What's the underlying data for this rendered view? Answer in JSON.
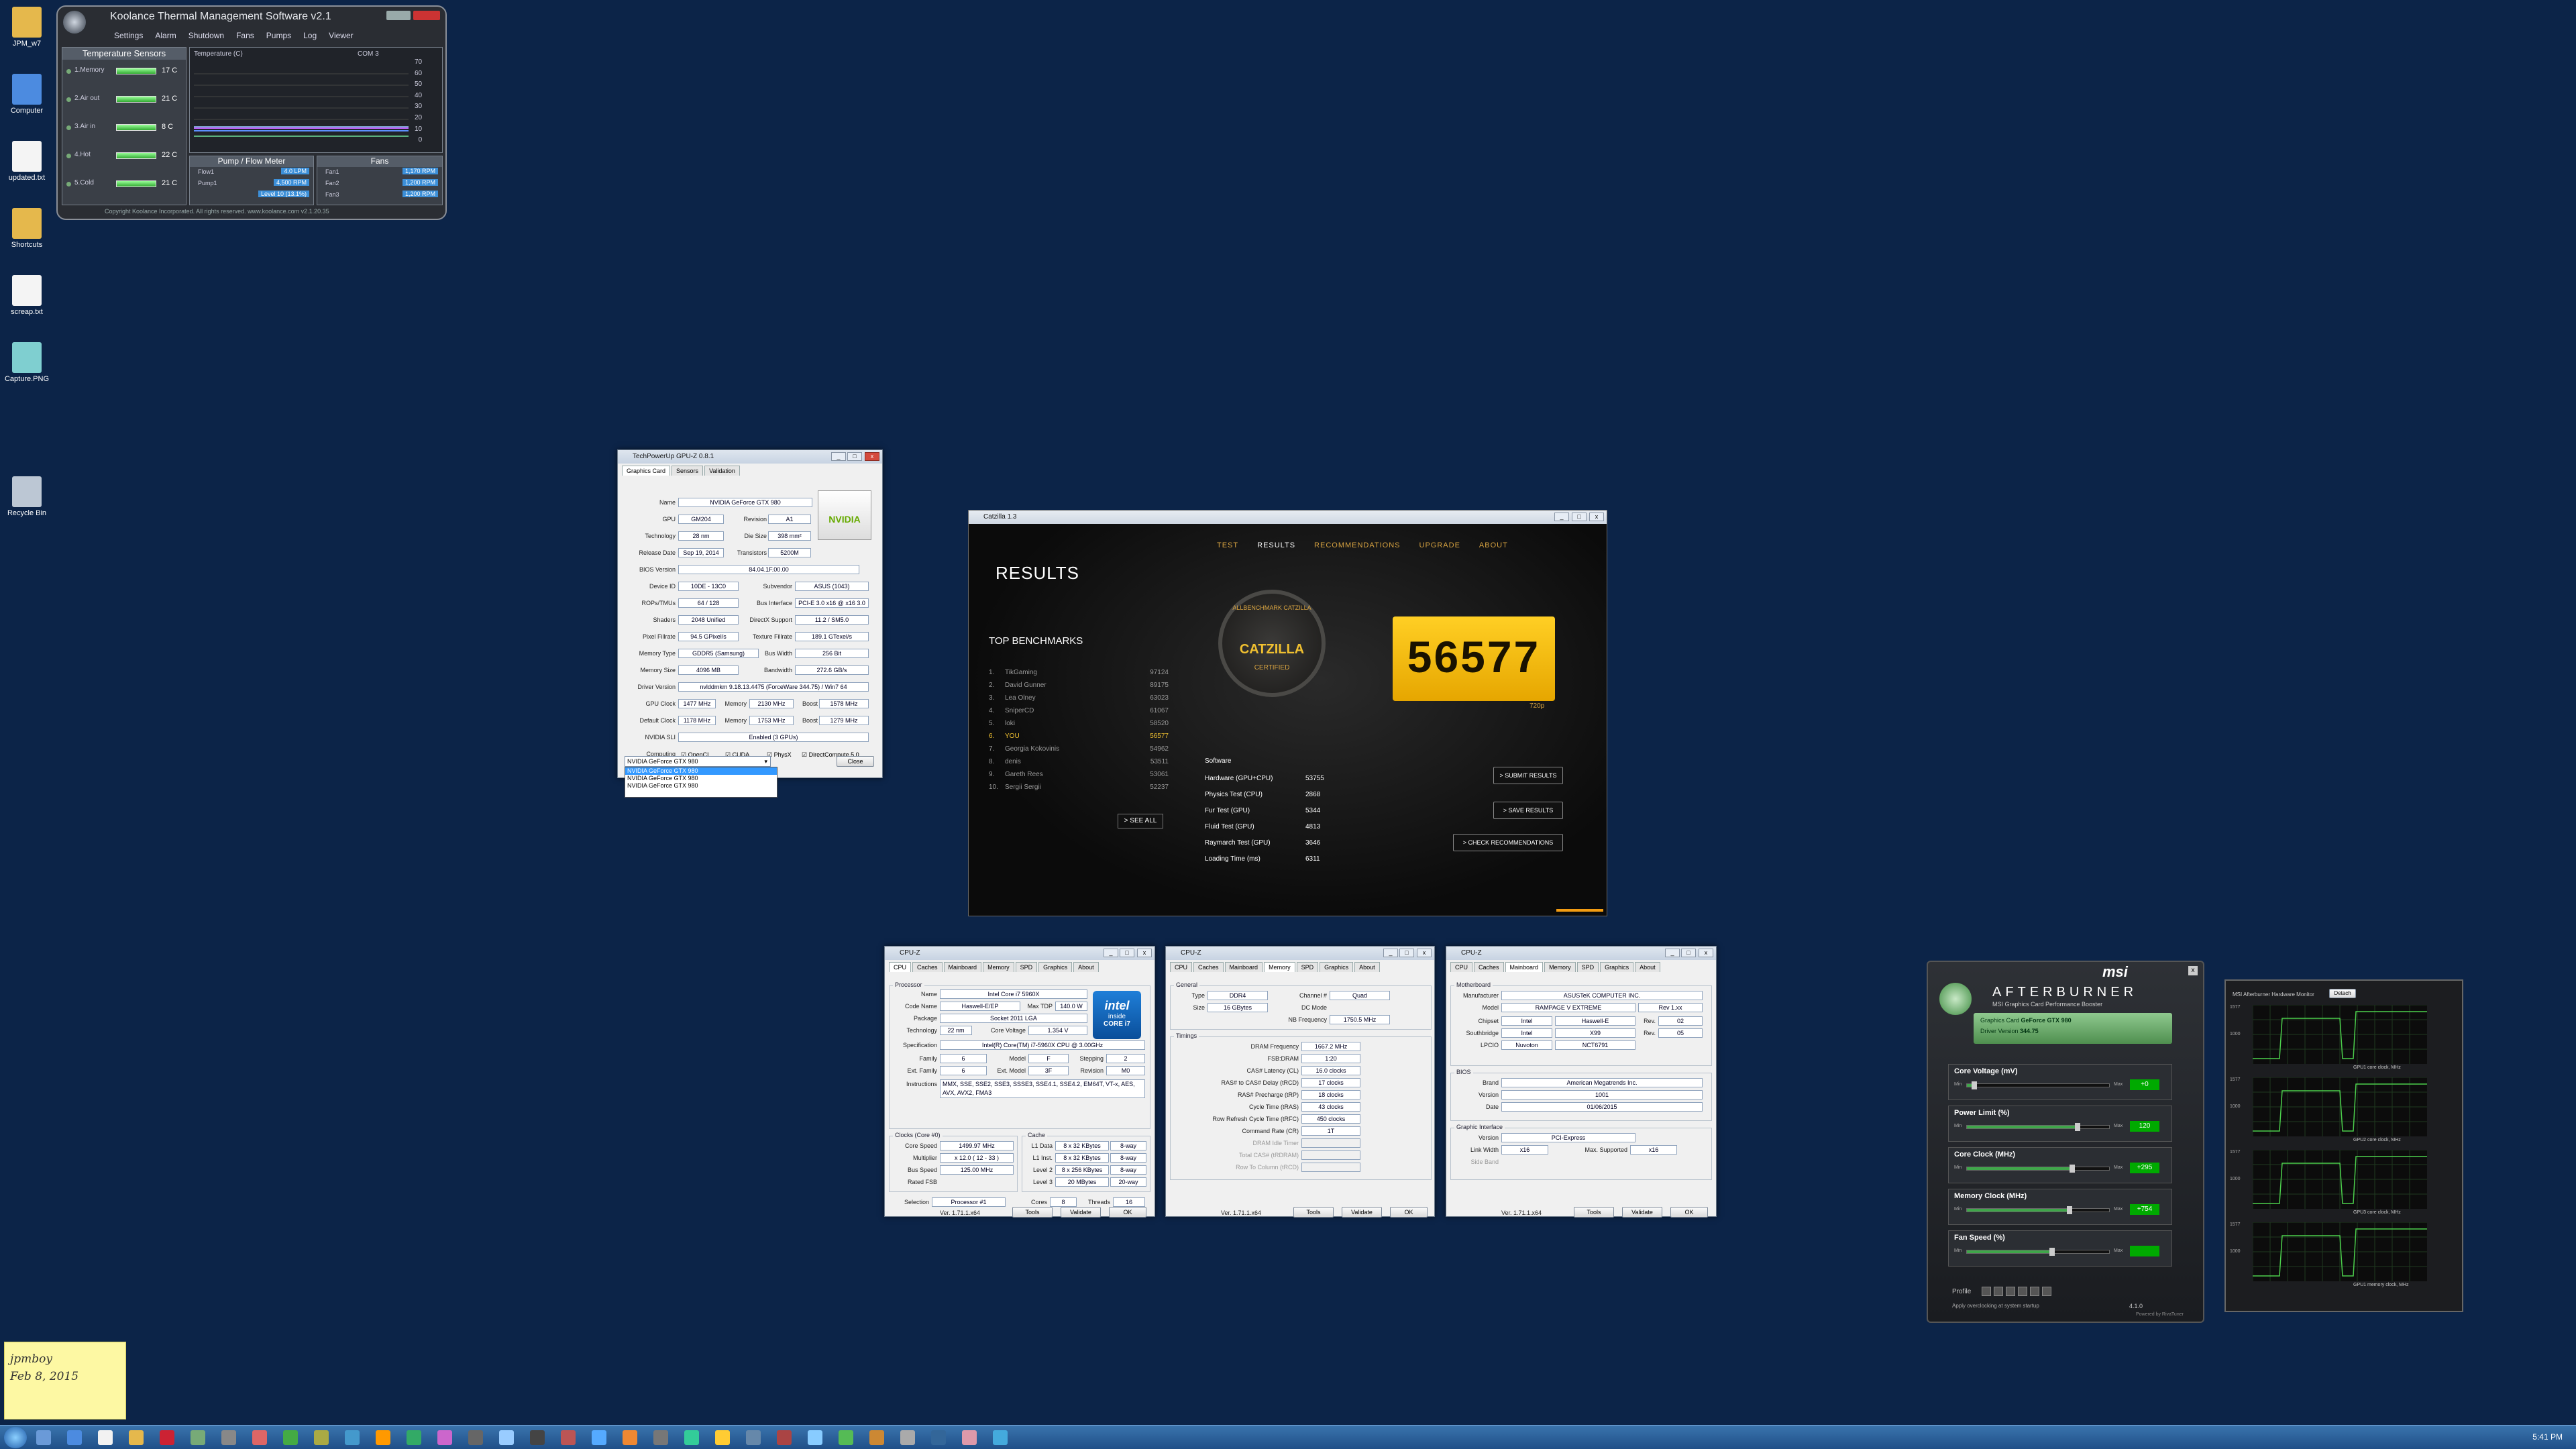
{
  "desktop": {
    "icons": [
      {
        "label": "JPM_w7",
        "color": "#e5b84c"
      },
      {
        "label": "Computer",
        "color": "#4c8be0"
      },
      {
        "label": "updated.txt",
        "color": "#f4f4f4"
      },
      {
        "label": "Shortcuts",
        "color": "#e5b84c"
      },
      {
        "label": "screap.txt",
        "color": "#f4f4f4"
      },
      {
        "label": "Capture.PNG",
        "color": "#7fcfd0"
      },
      {
        "label": "Recycle Bin",
        "color": "#bcc7d4"
      }
    ],
    "note": {
      "line1": "jpmboy",
      "line2": "Feb 8, 2015"
    }
  },
  "koolance": {
    "title": "Koolance Thermal Management Software v2.1",
    "menu": [
      "Settings",
      "Alarm",
      "Shutdown",
      "Fans",
      "Pumps",
      "Log",
      "Viewer"
    ],
    "sensors_title": "Temperature Sensors",
    "sensors": [
      {
        "name": "1.Memory",
        "val": "17 C"
      },
      {
        "name": "2.Air out",
        "val": "21 C"
      },
      {
        "name": "3.Air in",
        "val": "8 C"
      },
      {
        "name": "4.Hot",
        "val": "22 C"
      },
      {
        "name": "5.Cold",
        "val": "21 C"
      }
    ],
    "graph_title": "Temperature (C)",
    "graph_tag": "COM 3",
    "graph_ticks": [
      "70",
      "60",
      "50",
      "40",
      "30",
      "20",
      "10",
      "0"
    ],
    "pump_title": "Pump / Flow Meter",
    "fans_title": "Fans",
    "pump_rows": [
      {
        "name": "Flow1",
        "val": "4.0 LPM"
      },
      {
        "name": "Pump1",
        "val": "4,500 RPM"
      },
      {
        "name": "",
        "val": "Level 10 (13.1%)"
      }
    ],
    "fan_rows": [
      {
        "name": "Fan1",
        "val": "1,170 RPM"
      },
      {
        "name": "Fan2",
        "val": "1,200 RPM"
      },
      {
        "name": "Fan3",
        "val": "1,200 RPM"
      }
    ],
    "footer": "Copyright Koolance Incorporated. All rights reserved. www.koolance.com v2.1.20.35"
  },
  "gpuz": {
    "title": "TechPowerUp GPU-Z 0.8.1",
    "tabs": [
      "Graphics Card",
      "Sensors",
      "Validation"
    ],
    "name": "NVIDIA GeForce GTX 980",
    "gpu": "GM204",
    "revision": "A1",
    "technology": "28 nm",
    "die_size": "398 mm²",
    "release_date": "Sep 19, 2014",
    "transistors": "5200M",
    "bios": "84.04.1F.00.00",
    "device_id": "10DE - 13C0",
    "subvendor": "ASUS (1043)",
    "rops": "64 / 128",
    "bus_interface": "PCI-E 3.0 x16 @ x16 3.0",
    "shaders": "2048 Unified",
    "directx": "11.2 / SM5.0",
    "pixel_fill": "94.5 GPixel/s",
    "texture_fill": "189.1 GTexel/s",
    "memory_type": "GDDR5 (Samsung)",
    "bus_width": "256 Bit",
    "memory_size": "4096 MB",
    "bandwidth": "272.6 GB/s",
    "driver": "nvlddmkm 9.18.13.4475 (ForceWare 344.75) / Win7 64",
    "gpu_clock": "1477 MHz",
    "memory_clock": "2130 MHz",
    "boost": "1578 MHz",
    "default_clock": "1178 MHz",
    "default_memory": "1753 MHz",
    "default_boost": "1279 MHz",
    "sli": "Enabled (3 GPUs)",
    "computing": [
      "OpenCL",
      "CUDA",
      "PhysX",
      "DirectCompute 5.0"
    ],
    "labels": {
      "name": "Name",
      "gpu": "GPU",
      "revision": "Revision",
      "technology": "Technology",
      "die": "Die Size",
      "release": "Release Date",
      "transistors": "Transistors",
      "bios": "BIOS Version",
      "device": "Device ID",
      "subvendor": "Subvendor",
      "rops": "ROPs/TMUs",
      "bus": "Bus Interface",
      "shaders": "Shaders",
      "dx": "DirectX Support",
      "pixel": "Pixel Fillrate",
      "texture": "Texture Fillrate",
      "memtype": "Memory Type",
      "buswidth": "Bus Width",
      "memsize": "Memory Size",
      "bandwidth": "Bandwidth",
      "driver": "Driver Version",
      "gpuclock": "GPU Clock",
      "memory": "Memory",
      "boost": "Boost",
      "default": "Default Clock",
      "sli": "NVIDIA SLI",
      "computing": "Computing"
    },
    "dropdown": [
      "NVIDIA GeForce GTX 980",
      "NVIDIA GeForce GTX 980",
      "NVIDIA GeForce GTX 980",
      "NVIDIA GeForce GTX 980"
    ],
    "close": "Close",
    "logo": "NVIDIA"
  },
  "catzilla": {
    "title": "Catzilla 1.3",
    "nav": [
      "TEST",
      "RESULTS",
      "RECOMMENDATIONS",
      "UPGRADE",
      "ABOUT"
    ],
    "results": "RESULTS",
    "top": "TOP BENCHMARKS",
    "bench": [
      {
        "n": "1.",
        "name": "TikGaming",
        "score": "97124"
      },
      {
        "n": "2.",
        "name": "David Gunner",
        "score": "89175"
      },
      {
        "n": "3.",
        "name": "Lea Olney",
        "score": "63023"
      },
      {
        "n": "4.",
        "name": "SniperCD",
        "score": "61067"
      },
      {
        "n": "5.",
        "name": "loki",
        "score": "58520"
      },
      {
        "n": "6.",
        "name": "YOU",
        "score": "56577"
      },
      {
        "n": "7.",
        "name": "Georgia Kokovinis",
        "score": "54962"
      },
      {
        "n": "8.",
        "name": "denis",
        "score": "53511"
      },
      {
        "n": "9.",
        "name": "Gareth Rees",
        "score": "53061"
      },
      {
        "n": "10.",
        "name": "Sergii Sergii",
        "score": "52237"
      }
    ],
    "see_all": "> SEE ALL",
    "badge": [
      "ALLBENCHMARK CATZILLA",
      "CATZILLA",
      "CERTIFIED"
    ],
    "score": "56577",
    "res": "720p",
    "software": "Software",
    "stats": [
      {
        "name": "Hardware (GPU+CPU)",
        "val": "53755"
      },
      {
        "name": "Physics Test (CPU)",
        "val": "2868"
      },
      {
        "name": "Fur Test (GPU)",
        "val": "5344"
      },
      {
        "name": "Fluid Test (GPU)",
        "val": "4813"
      },
      {
        "name": "Raymarch Test (GPU)",
        "val": "3646"
      },
      {
        "name": "Loading Time (ms)",
        "val": "6311"
      }
    ],
    "buttons": [
      "> SUBMIT RESULTS",
      "> SAVE RESULTS",
      "> CHECK RECOMMENDATIONS"
    ]
  },
  "cpuz1": {
    "title": "CPU-Z",
    "tabs": [
      "CPU",
      "Caches",
      "Mainboard",
      "Memory",
      "SPD",
      "Graphics",
      "About"
    ],
    "processor": "Processor",
    "name": "Intel Core i7 5960X",
    "code_name": "Haswell-E/EP",
    "max_tdp": "140.0 W",
    "package": "Socket 2011 LGA",
    "technology": "22 nm",
    "core_voltage": "1.354 V",
    "spec": "Intel(R) Core(TM) i7-5960X CPU @ 3.00GHz",
    "family": "6",
    "model": "F",
    "stepping": "2",
    "ext_family": "6",
    "ext_model": "3F",
    "revision": "M0",
    "instructions": "MMX, SSE, SSE2, SSE3, SSSE3, SSE4.1, SSE4.2, EM64T, VT-x, AES, AVX, AVX2, FMA3",
    "clocks": "Clocks (Core #0)",
    "core_speed": "1499.97 MHz",
    "multiplier": "x 12.0 ( 12 - 33 )",
    "bus_speed": "125.00 MHz",
    "rated_fsb": "Rated FSB",
    "cache": "Cache",
    "l1d": "8 x 32 KBytes",
    "l1d_way": "8-way",
    "l1i": "8 x 32 KBytes",
    "l1i_way": "8-way",
    "l2": "8 x 256 KBytes",
    "l2_way": "8-way",
    "l3": "20 MBytes",
    "l3_way": "20-way",
    "selection": "Processor #1",
    "cores": "8",
    "threads": "16",
    "version": "Ver. 1.71.1.x64",
    "tools": "Tools",
    "validate": "Validate",
    "ok": "OK",
    "intel": [
      "intel",
      "inside",
      "CORE i7"
    ],
    "labels": {
      "name": "Name",
      "code": "Code Name",
      "tdp": "Max TDP",
      "package": "Package",
      "tech": "Technology",
      "cv": "Core Voltage",
      "spec": "Specification",
      "family": "Family",
      "model": "Model",
      "stepping": "Stepping",
      "extfam": "Ext. Family",
      "extmodel": "Ext. Model",
      "rev": "Revision",
      "instr": "Instructions",
      "cs": "Core Speed",
      "mult": "Multiplier",
      "bus": "Bus Speed",
      "l1d": "L1 Data",
      "l1i": "L1 Inst.",
      "l2": "Level 2",
      "l3": "Level 3",
      "sel": "Selection",
      "cores": "Cores",
      "threads": "Threads"
    }
  },
  "cpuz2": {
    "title": "CPU-Z",
    "tabs": [
      "CPU",
      "Caches",
      "Mainboard",
      "Memory",
      "SPD",
      "Graphics",
      "About"
    ],
    "general": "General",
    "type": "DDR4",
    "channel": "Quad",
    "size": "16 GBytes",
    "dc_mode": "DC Mode",
    "nb_freq": "1750.5 MHz",
    "timings": "Timings",
    "dram_freq": "1667.2 MHz",
    "fsb_dram": "1:20",
    "cas": "16.0 clocks",
    "rcd": "17 clocks",
    "rp": "18 clocks",
    "ras": "43 clocks",
    "rfc": "450 clocks",
    "cr": "1T",
    "idle": "DRAM Idle Timer",
    "total_cas": "Total CAS# (tRDRAM)",
    "row_col": "Row To Column (tRCD)",
    "labels": {
      "type": "Type",
      "channel": "Channel #",
      "size": "Size",
      "nb": "NB Frequency",
      "df": "DRAM Frequency",
      "fsb": "FSB:DRAM",
      "cas": "CAS# Latency (CL)",
      "rcd": "RAS# to CAS# Delay (tRCD)",
      "rp": "RAS# Precharge (tRP)",
      "ras": "Cycle Time (tRAS)",
      "rfc": "Row Refresh Cycle Time (tRFC)",
      "cr": "Command Rate (CR)"
    },
    "version": "Ver. 1.71.1.x64",
    "tools": "Tools",
    "validate": "Validate",
    "ok": "OK"
  },
  "cpuz3": {
    "title": "CPU-Z",
    "tabs": [
      "CPU",
      "Caches",
      "Mainboard",
      "Memory",
      "SPD",
      "Graphics",
      "About"
    ],
    "motherboard": "Motherboard",
    "manufacturer": "ASUSTeK COMPUTER INC.",
    "model": "RAMPAGE V EXTREME",
    "model_rev": "Rev 1.xx",
    "chipset": "Intel",
    "chipset_name": "Haswell-E",
    "chipset_rev": "02",
    "south": "Intel",
    "south_name": "X99",
    "south_rev": "05",
    "lpcio": "Nuvoton",
    "lpcio_name": "NCT6791",
    "bios": "BIOS",
    "brand": "American Megatrends Inc.",
    "bios_version": "1001",
    "bios_date": "01/06/2015",
    "gi": "Graphic Interface",
    "gi_version": "PCI-Express",
    "link_width": "x16",
    "max_supported": "x16",
    "side_band": "Side Band",
    "labels": {
      "manu": "Manufacturer",
      "model": "Model",
      "chipset": "Chipset",
      "south": "Southbridge",
      "lpcio": "LPCIO",
      "brand": "Brand",
      "version": "Version",
      "date": "Date",
      "rev": "Rev.",
      "lw": "Link Width",
      "max": "Max. Supported"
    },
    "version": "Ver. 1.71.1.x64",
    "tools": "Tools",
    "validate": "Validate",
    "ok": "OK"
  },
  "afterburner": {
    "brand": "msi",
    "title": "AFTERBURNER",
    "subtitle": "MSI Graphics Card Performance Booster",
    "card_label": "Graphics Card",
    "card": "GeForce GTX 980",
    "driver_label": "Driver Version",
    "driver": "344.75",
    "sliders": [
      {
        "name": "Core Voltage (mV)",
        "val": "+0",
        "fill": 0.05
      },
      {
        "name": "Power Limit (%)",
        "val": "120",
        "fill": 0.78
      },
      {
        "name": "Core Clock (MHz)",
        "val": "+295",
        "fill": 0.74
      },
      {
        "name": "Memory Clock (MHz)",
        "val": "+754",
        "fill": 0.72
      },
      {
        "name": "Fan Speed (%)",
        "val": "",
        "fill": 0.6
      }
    ],
    "min": "Min",
    "max": "Max",
    "auto": "Auto",
    "profile": "Profile",
    "apply": "Apply overclocking at system startup",
    "version": "4.1.0",
    "powered": "Powered by RivaTuner",
    "monitor_title": "MSI Afterburner Hardware Monitor",
    "detach": "Detach",
    "graphs": [
      {
        "label": "GPU1 core clock, MHz",
        "top": "1577",
        "mid": "1000"
      },
      {
        "label": "GPU2 core clock, MHz",
        "top": "1577",
        "mid": "1000"
      },
      {
        "label": "GPU3 core clock, MHz",
        "top": "1577",
        "mid": "1000"
      },
      {
        "label": "GPU1 memory clock, MHz",
        "top": "1577",
        "mid": "1000"
      }
    ],
    "axis": [
      "Min",
      "Max"
    ]
  },
  "taskbar": {
    "time": "5:41 PM"
  }
}
